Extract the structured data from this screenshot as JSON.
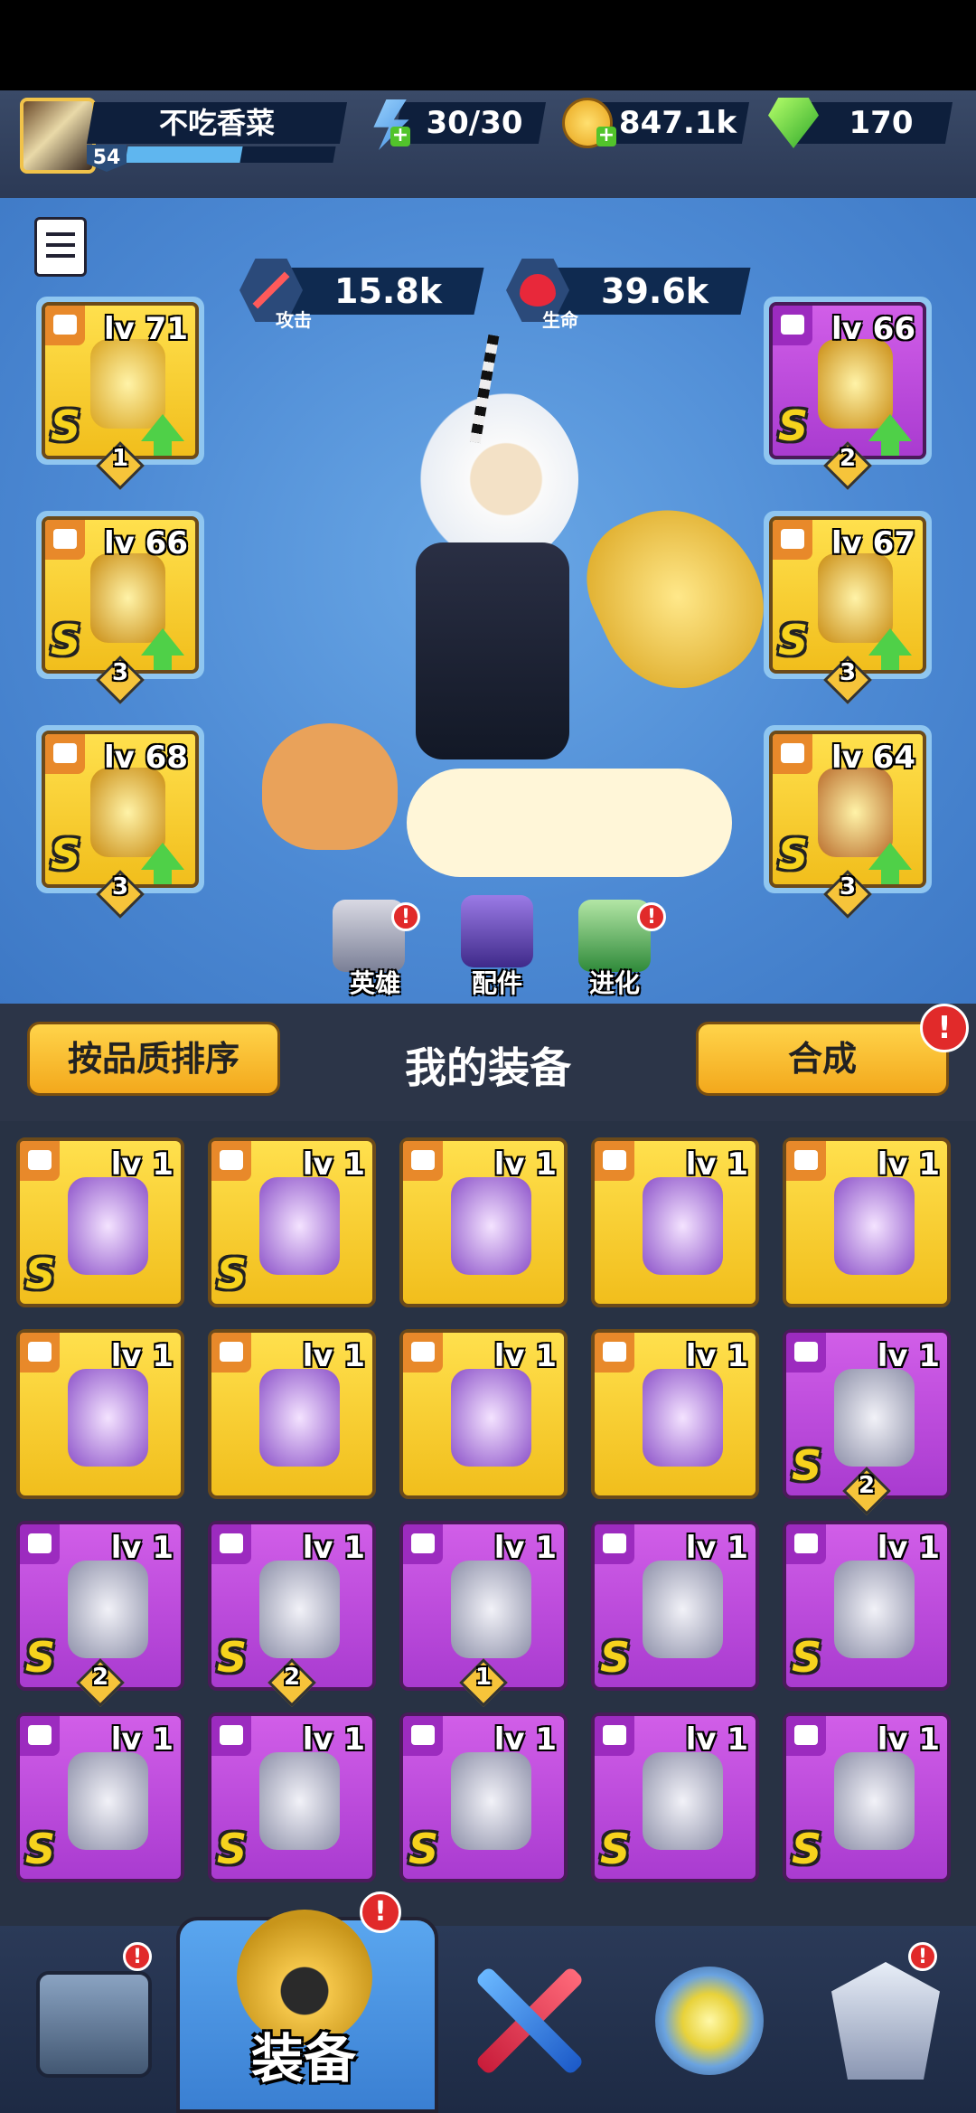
{
  "player": {
    "name": "不吃香菜",
    "level": "54",
    "xp_fraction": 0.55
  },
  "resources": {
    "energy": "30/30",
    "gold": "847.1k",
    "gems": "170"
  },
  "hero": {
    "attack_value": "15.8k",
    "attack_label": "攻击",
    "life_value": "39.6k",
    "life_label": "生命"
  },
  "equipped": {
    "left": [
      {
        "lv": "lv 71",
        "grade": "S",
        "stars": "1",
        "rarity": "gold",
        "type": "weapon-icon"
      },
      {
        "lv": "lv 66",
        "grade": "S",
        "stars": "3",
        "rarity": "gold",
        "type": "helmet-icon"
      },
      {
        "lv": "lv 68",
        "grade": "S",
        "stars": "3",
        "rarity": "gold",
        "type": "glove-icon"
      }
    ],
    "right": [
      {
        "lv": "lv 66",
        "grade": "S",
        "stars": "2",
        "rarity": "purple",
        "type": "armor-icon"
      },
      {
        "lv": "lv 67",
        "grade": "S",
        "stars": "3",
        "rarity": "gold",
        "type": "belt-icon"
      },
      {
        "lv": "lv 64",
        "grade": "S",
        "stars": "3",
        "rarity": "gold",
        "type": "boots-icon"
      }
    ]
  },
  "hero_tabs": [
    {
      "label": "英雄"
    },
    {
      "label": "配件"
    },
    {
      "label": "进化"
    }
  ],
  "controls": {
    "sort_label": "按品质排序",
    "section_title": "我的装备",
    "combine_label": "合成",
    "alert_mark": "!"
  },
  "inventory": [
    [
      {
        "lv": "lv 1",
        "rarity": "gold",
        "grade": "S",
        "stars": "",
        "type": "weapon-icon"
      },
      {
        "lv": "lv 1",
        "rarity": "gold",
        "grade": "S",
        "stars": "",
        "type": "glove-icon"
      },
      {
        "lv": "lv 1",
        "rarity": "gold",
        "grade": "",
        "stars": "",
        "type": "weapon-icon"
      },
      {
        "lv": "lv 1",
        "rarity": "gold",
        "grade": "",
        "stars": "",
        "type": "weapon-icon"
      },
      {
        "lv": "lv 1",
        "rarity": "gold",
        "grade": "",
        "stars": "",
        "type": "weapon-icon"
      }
    ],
    [
      {
        "lv": "lv 1",
        "rarity": "gold",
        "grade": "",
        "stars": "",
        "type": "weapon-icon"
      },
      {
        "lv": "lv 1",
        "rarity": "gold",
        "grade": "",
        "stars": "",
        "type": "helmet-icon"
      },
      {
        "lv": "lv 1",
        "rarity": "gold",
        "grade": "",
        "stars": "",
        "type": "armor-icon"
      },
      {
        "lv": "lv 1",
        "rarity": "gold",
        "grade": "",
        "stars": "",
        "type": "belt-icon"
      },
      {
        "lv": "lv 1",
        "rarity": "purple",
        "grade": "S",
        "stars": "2",
        "type": "weapon-icon"
      }
    ],
    [
      {
        "lv": "lv 1",
        "rarity": "purple",
        "grade": "S",
        "stars": "2",
        "type": "helmet-icon"
      },
      {
        "lv": "lv 1",
        "rarity": "purple",
        "grade": "S",
        "stars": "2",
        "type": "belt-icon"
      },
      {
        "lv": "lv 1",
        "rarity": "purple",
        "grade": "",
        "stars": "1",
        "type": "boots-icon"
      },
      {
        "lv": "lv 1",
        "rarity": "purple",
        "grade": "S",
        "stars": "",
        "type": "weapon-icon"
      },
      {
        "lv": "lv 1",
        "rarity": "purple",
        "grade": "S",
        "stars": "",
        "type": "weapon-icon"
      }
    ],
    [
      {
        "lv": "lv 1",
        "rarity": "purple",
        "grade": "S",
        "stars": "",
        "type": "weapon-icon"
      },
      {
        "lv": "lv 1",
        "rarity": "purple",
        "grade": "S",
        "stars": "",
        "type": "weapon-icon"
      },
      {
        "lv": "lv 1",
        "rarity": "purple",
        "grade": "S",
        "stars": "",
        "type": "helmet-icon"
      },
      {
        "lv": "lv 1",
        "rarity": "purple",
        "grade": "S",
        "stars": "",
        "type": "armor-icon"
      },
      {
        "lv": "lv 1",
        "rarity": "purple",
        "grade": "S",
        "stars": "",
        "type": "belt-icon"
      }
    ]
  ],
  "nav": {
    "active_label": "装备",
    "items": [
      "treasure-chest-icon",
      "equipment-helmet-icon",
      "crossed-swords-icon",
      "energy-orb-icon",
      "rank-crest-icon"
    ]
  },
  "colors": {
    "gold_rarity": "#f1be1c",
    "purple_rarity": "#a93bd0",
    "upgrade_arrow": "#4fd048",
    "alert": "#e12a2a"
  }
}
